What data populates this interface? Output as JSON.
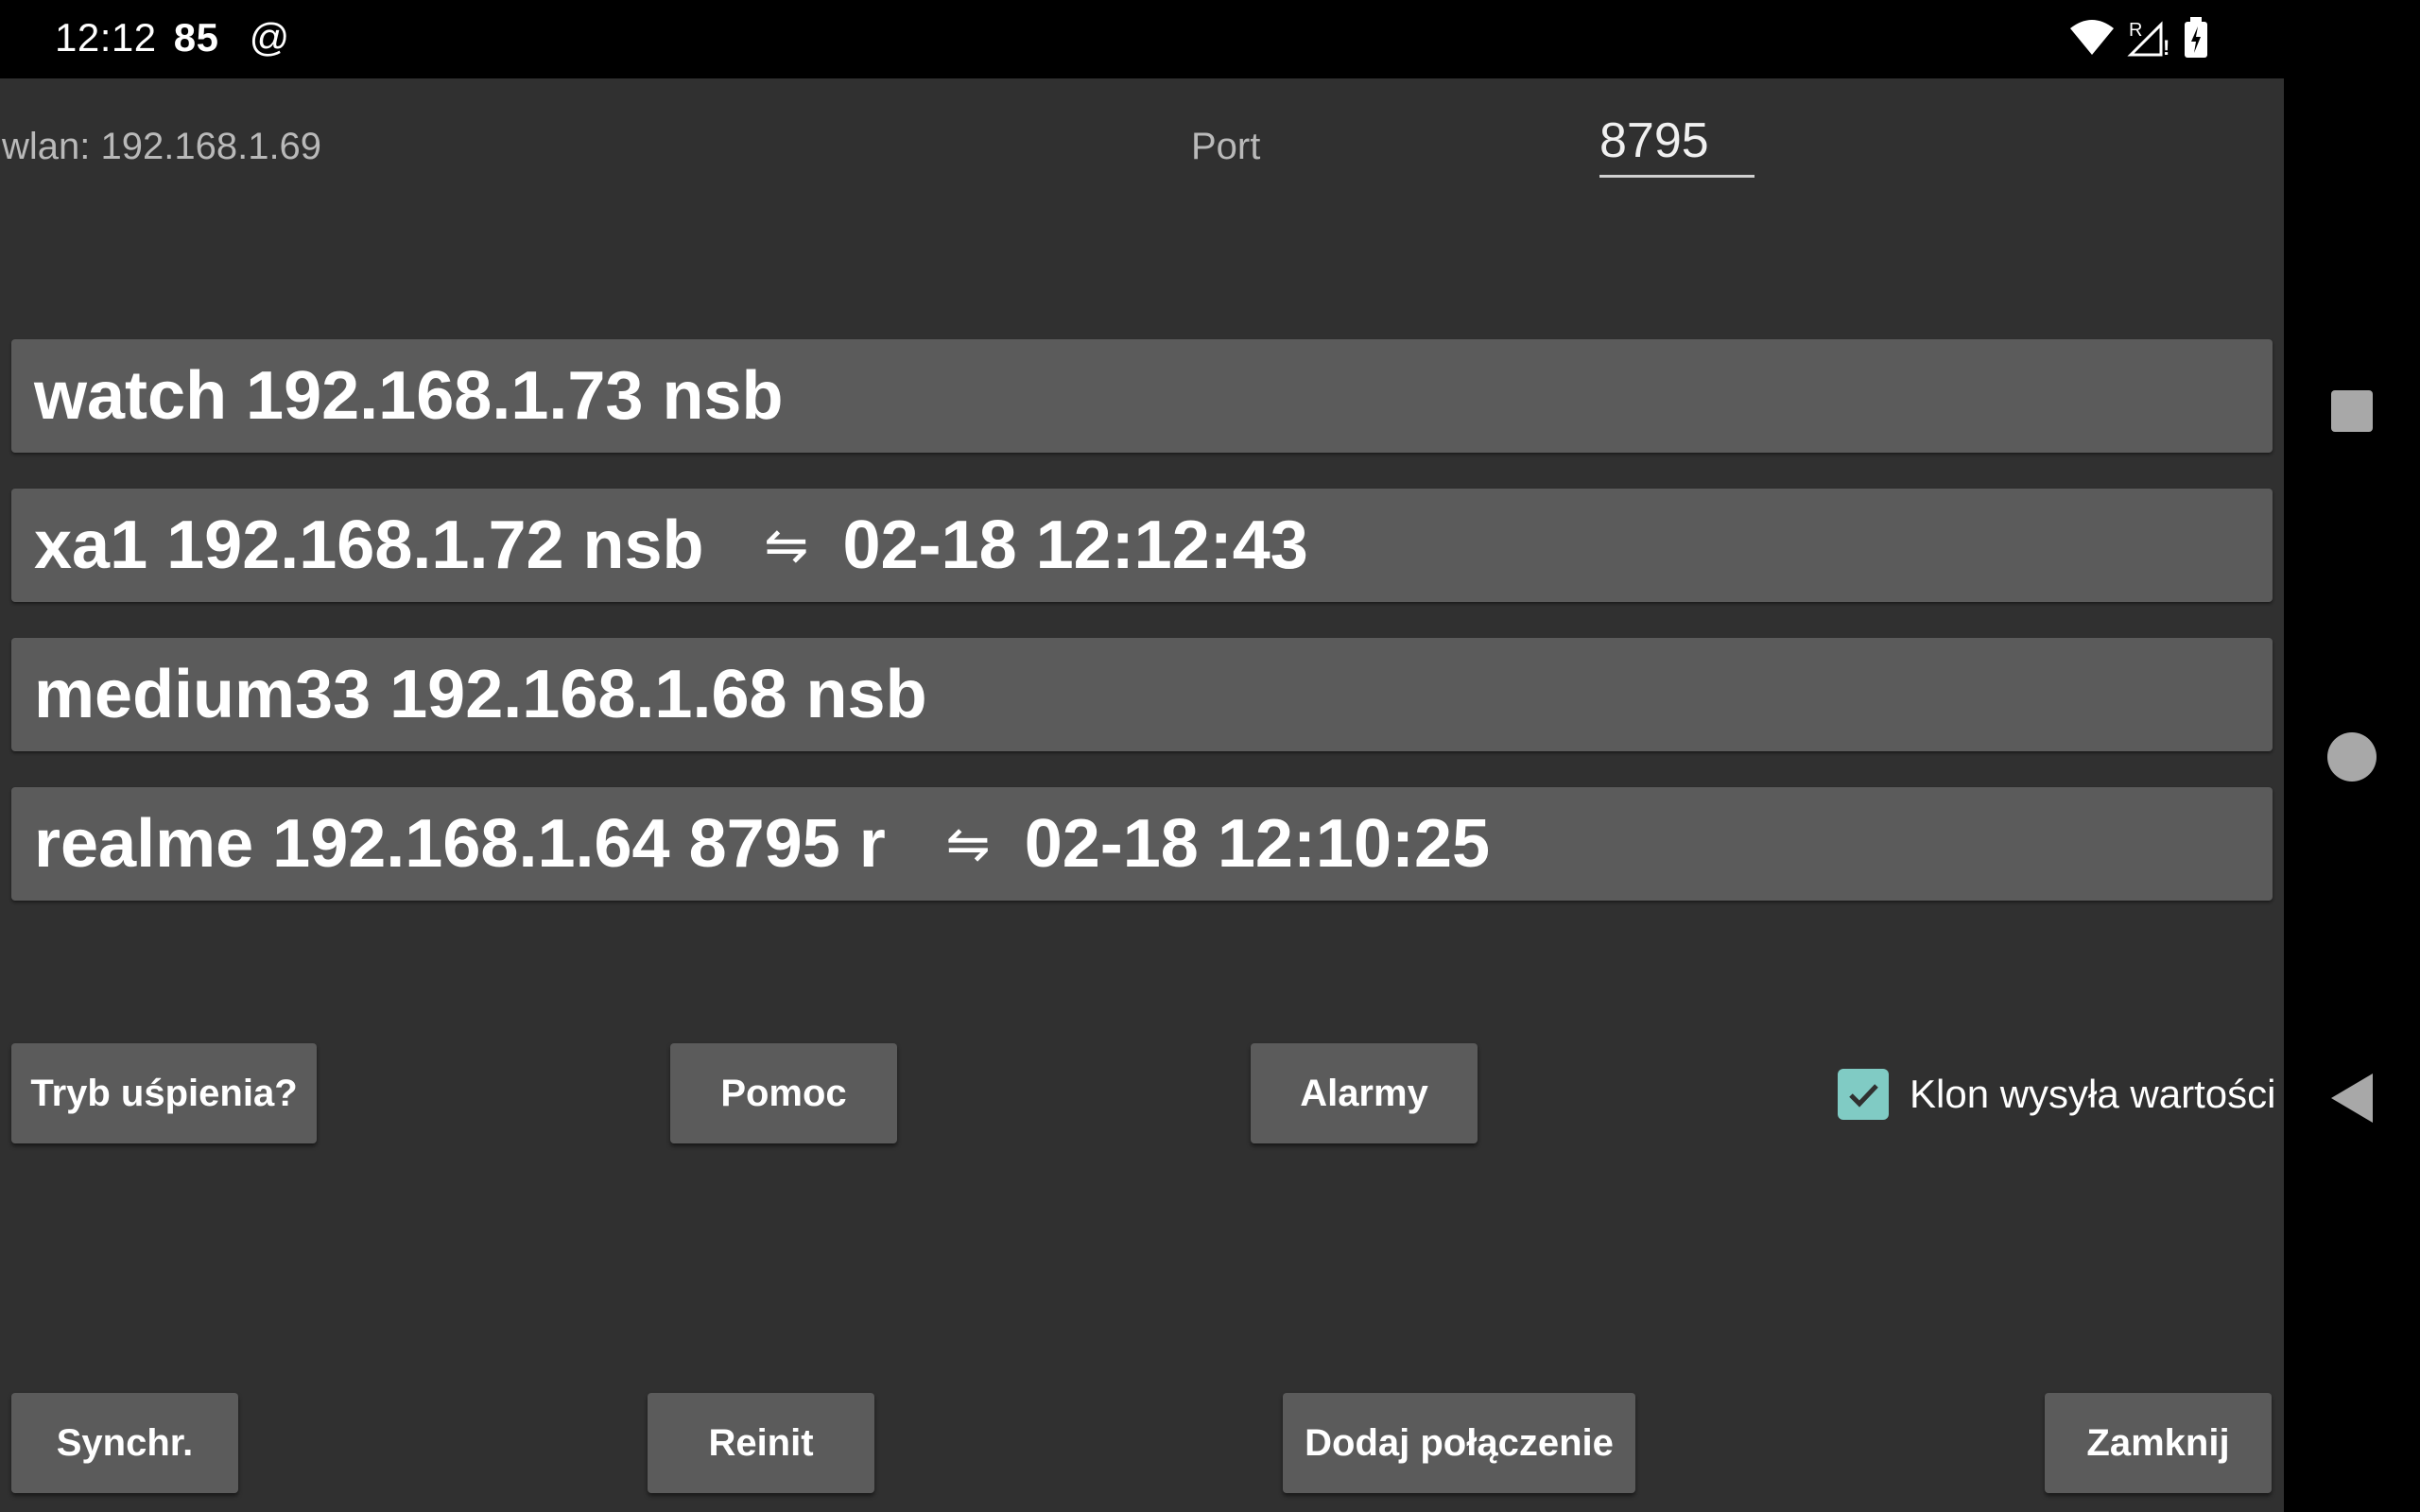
{
  "status_bar": {
    "time": "12:12",
    "extra": "85",
    "at": "@",
    "icons": [
      "wifi-icon",
      "signal-roaming-icon",
      "battery-charging-icon"
    ]
  },
  "network": {
    "wlan": "wlan: 192.168.1.69",
    "port_label": "Port",
    "port_value": "8795"
  },
  "connections": [
    {
      "name": "watch 192.168.1.73 nsb",
      "sync_arrow": "",
      "timestamp": ""
    },
    {
      "name": "xa1 192.168.1.72 nsb",
      "sync_arrow": "⇋",
      "timestamp": "02-18 12:12:43"
    },
    {
      "name": "medium33 192.168.1.68 nsb",
      "sync_arrow": "",
      "timestamp": ""
    },
    {
      "name": "realme 192.168.1.64 8795 r",
      "sync_arrow": "⇋",
      "timestamp": "02-18 12:10:25"
    }
  ],
  "buttons_row1": {
    "sleep": "Tryb uśpienia?",
    "help": "Pomoc",
    "alarms": "Alarmy"
  },
  "checkbox": {
    "label": "Klon wysyła wartości",
    "checked": true,
    "color": "#80cbc4"
  },
  "buttons_row2": {
    "sync": "Synchr.",
    "reinit": "Reinit",
    "add_connection": "Dodaj połączenie",
    "close": "Zamknij"
  },
  "nav_bar": {
    "icons": [
      "recents-icon",
      "home-icon",
      "back-icon"
    ]
  }
}
